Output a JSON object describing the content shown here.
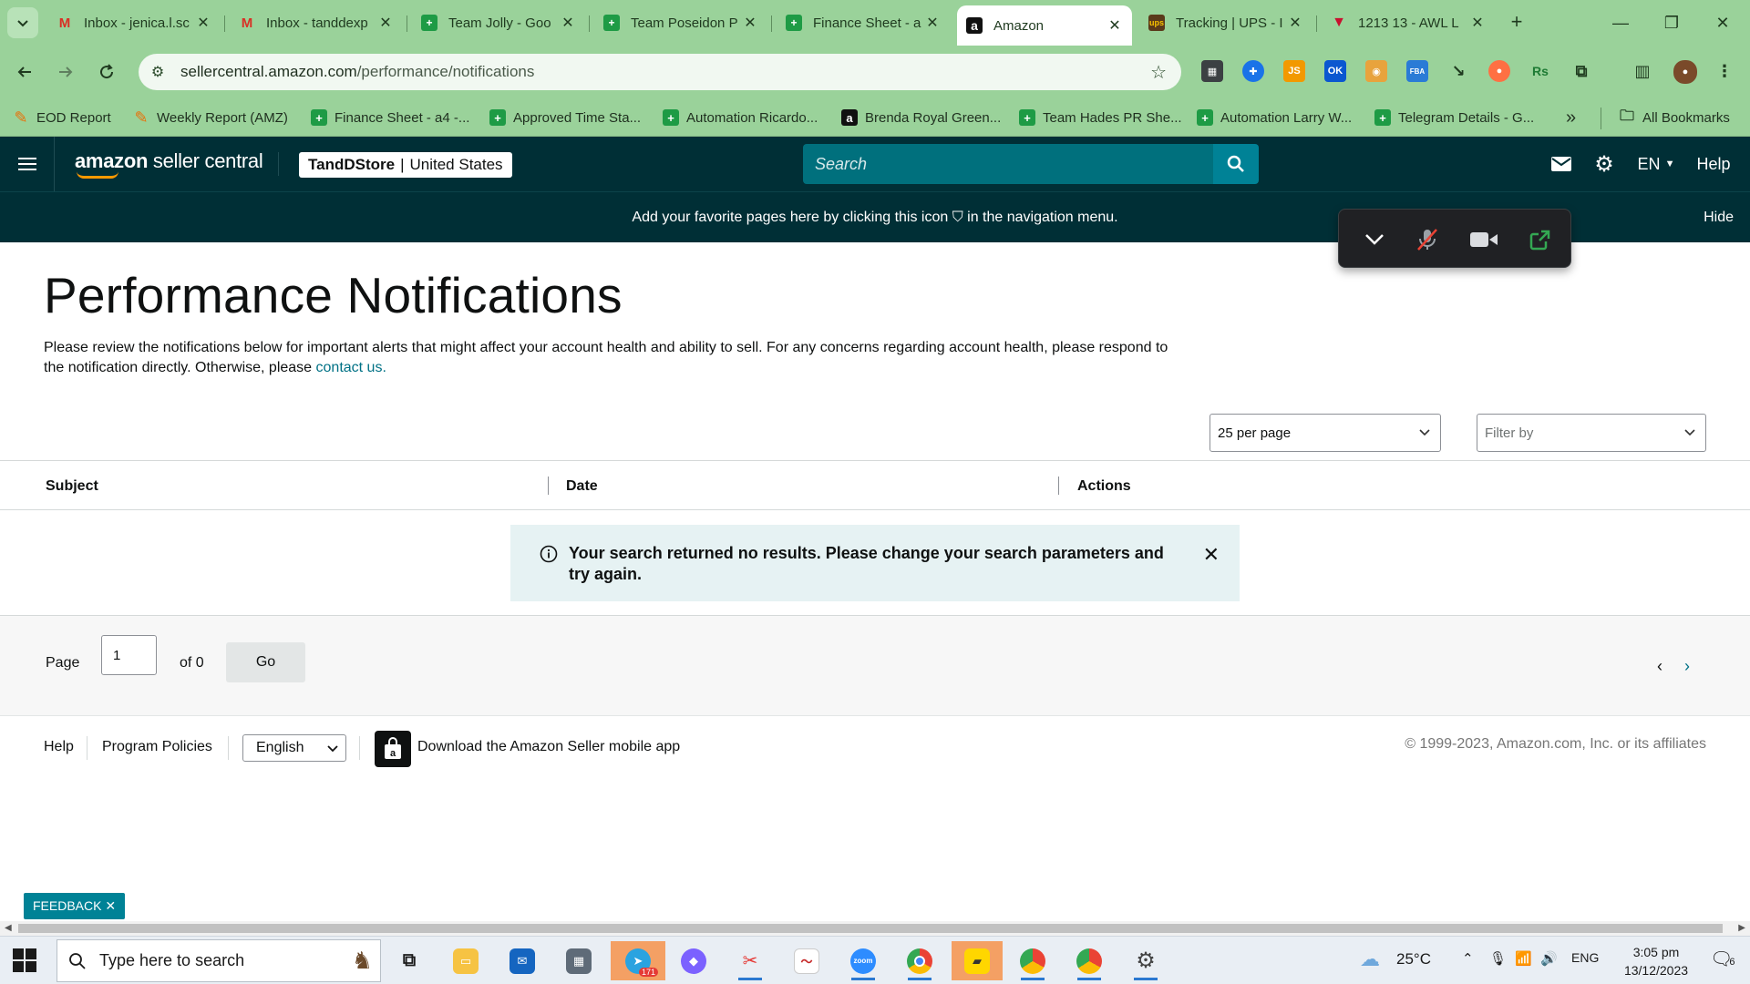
{
  "browser": {
    "tabs": [
      {
        "title": "Inbox - jenica.l.sc",
        "icon": "gmail-icon",
        "active": false
      },
      {
        "title": "Inbox - tanddexp",
        "icon": "gmail-icon",
        "active": false
      },
      {
        "title": "Team Jolly - Goo",
        "icon": "sheets-icon",
        "active": false
      },
      {
        "title": "Team Poseidon P",
        "icon": "sheets-icon",
        "active": false
      },
      {
        "title": "Finance Sheet - a",
        "icon": "sheets-icon",
        "active": false
      },
      {
        "title": "Amazon",
        "icon": "amazon-icon",
        "active": true
      },
      {
        "title": "Tracking | UPS - I",
        "icon": "ups-icon",
        "active": false
      },
      {
        "title": "1213 13 - AWL L",
        "icon": "awl-icon",
        "active": false
      }
    ],
    "close_glyph": "✕",
    "new_tab_glyph": "+",
    "window_controls": {
      "minimize": "—",
      "restore": "❐",
      "close": "✕"
    },
    "url_host": "sellercentral.amazon.com",
    "url_path": "/performance/notifications",
    "bookmarks": [
      {
        "label": "EOD Report",
        "icon": "pencil-icon"
      },
      {
        "label": "Weekly Report (AMZ)",
        "icon": "pencil-icon"
      },
      {
        "label": "Finance Sheet - a4 -...",
        "icon": "sheets-icon"
      },
      {
        "label": "Approved Time Sta...",
        "icon": "sheets-icon"
      },
      {
        "label": "Automation Ricardo...",
        "icon": "sheets-icon"
      },
      {
        "label": "Brenda Royal Green...",
        "icon": "amazon-icon"
      },
      {
        "label": "Team Hades PR She...",
        "icon": "sheets-icon"
      },
      {
        "label": "Automation Larry W...",
        "icon": "sheets-icon"
      },
      {
        "label": "Telegram Details - G...",
        "icon": "sheets-icon"
      }
    ],
    "bookmarks_more": "»",
    "all_bookmarks": "All Bookmarks"
  },
  "seller_central": {
    "logo_prefix": "amazon",
    "logo_suffix": " seller central",
    "store_name": "TandDStore",
    "store_region": "United States",
    "search_placeholder": "Search",
    "language": "EN",
    "help": "Help",
    "favorites_message": "Add your favorite pages here by clicking this icon ⛉ in the navigation menu.",
    "hide_label": "Hide"
  },
  "page": {
    "title": "Performance Notifications",
    "description": "Please review the notifications below for important alerts that might affect your account health and ability to sell. For any concerns regarding account health, please respond to the notification directly. Otherwise, please ",
    "contact_link": "contact us.",
    "per_page": "25 per page",
    "filter_placeholder": "Filter by",
    "columns": [
      "Subject",
      "Date",
      "Actions"
    ],
    "no_results": "Your search returned no results. Please change your search parameters and try again.",
    "pager": {
      "page_label": "Page",
      "page_value": "1",
      "of_label": "of 0",
      "go_label": "Go"
    }
  },
  "footer": {
    "help": "Help",
    "program_policies": "Program Policies",
    "language": "English",
    "app_download": "Download the Amazon Seller mobile app",
    "copyright": "© 1999-2023, Amazon.com, Inc. or its affiliates"
  },
  "feedback_label": "FEEDBACK ✕",
  "taskbar": {
    "search_placeholder": "Type here to search",
    "telegram_badge": "171",
    "temperature": "25°C",
    "language": "ENG",
    "time": "3:05 pm",
    "date": "13/12/2023",
    "notification_count": "6"
  },
  "colors": {
    "header_bg": "#002f36",
    "search_bg": "#00707d",
    "link": "#007185",
    "alert_bg": "#e6f2f3",
    "browser_frame": "#9ad29a"
  }
}
